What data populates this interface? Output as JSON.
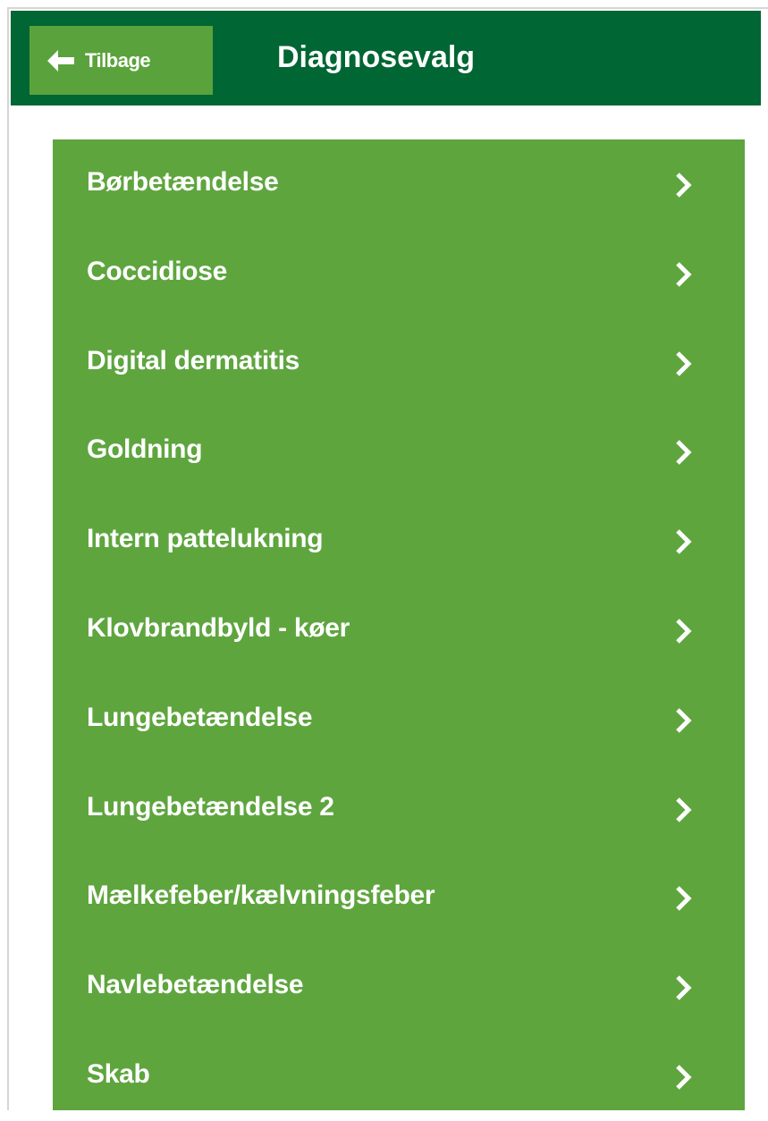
{
  "header": {
    "back_label": "Tilbage",
    "back_icon": "arrow-left-icon",
    "title": "Diagnosevalg",
    "color": "#006633"
  },
  "diagnoses": {
    "accent_color": "#5ea53e",
    "chevron_icon": "chevron-right-icon",
    "items": [
      "Børbetændelse",
      "Coccidiose",
      "Digital dermatitis",
      "Goldning",
      "Intern pattelukning",
      "Klovbrandbyld - køer",
      "Lungebetændelse",
      "Lungebetændelse 2",
      "Mælkefeber/kælvningsfeber",
      "Navlebetændelse",
      "Skab"
    ]
  }
}
